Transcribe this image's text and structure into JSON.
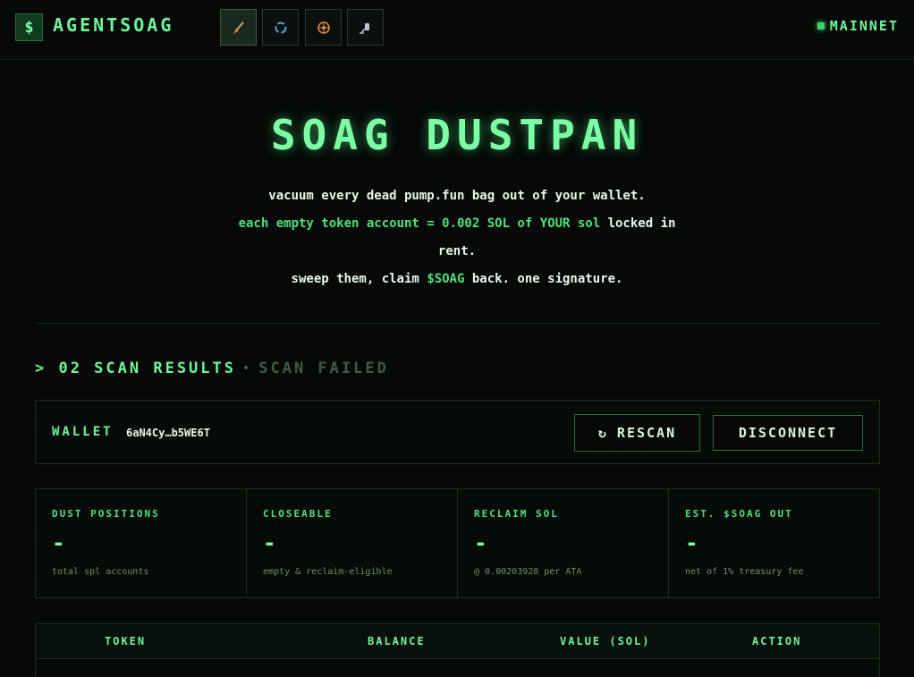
{
  "brand": {
    "symbol": "$",
    "name": "AGENTSOAG"
  },
  "nav": [
    {
      "icon": "broom-icon",
      "glyph": "🧹"
    },
    {
      "icon": "recycle-icon",
      "glyph": "♻"
    },
    {
      "icon": "wheel-icon",
      "glyph": "☸"
    },
    {
      "icon": "vacuum-icon",
      "glyph": "✈"
    }
  ],
  "network": {
    "label": "MAINNET"
  },
  "hero": {
    "title": "SOAG DUSTPAN",
    "line1": "vacuum every dead pump.fun bag out of your wallet.",
    "line2a": "each empty token account = 0.002 SOL of YOUR sol",
    "line2b": "locked in rent.",
    "line3a": "sweep them, claim ",
    "line3b": "$SOAG",
    "line3c": " back. one signature."
  },
  "section": {
    "prefix": "> 02 SCAN RESULTS",
    "separator": "·",
    "status": "SCAN FAILED"
  },
  "wallet": {
    "label": "WALLET",
    "address": "6aN4Cy…b5WE6T"
  },
  "buttons": {
    "rescan_icon": "↻",
    "rescan": "RESCAN",
    "disconnect": "DISCONNECT"
  },
  "stats": [
    {
      "label": "DUST POSITIONS",
      "value": "-",
      "note": "total spl accounts"
    },
    {
      "label": "CLOSEABLE",
      "value": "-",
      "note": "empty & reclaim-eligible"
    },
    {
      "label": "RECLAIM SOL",
      "value": "-",
      "note": "@ 0.00203928 per ATA"
    },
    {
      "label": "EST. $SOAG OUT",
      "value": "-",
      "note": "net of 1% treasury fee"
    }
  ],
  "table": {
    "columns": [
      "TOKEN",
      "BALANCE",
      "VALUE (SOL)",
      "ACTION"
    ]
  }
}
